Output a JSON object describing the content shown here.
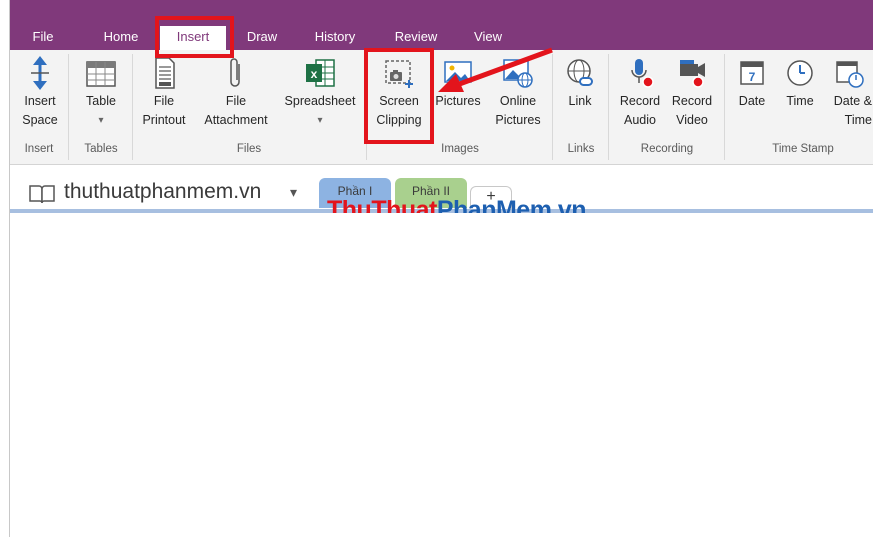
{
  "tabs": [
    "File",
    "Home",
    "Insert",
    "Draw",
    "History",
    "Review",
    "View"
  ],
  "active_tab": "Insert",
  "ribbon": {
    "insert_space": [
      "Insert",
      "Space"
    ],
    "table": [
      "Table",
      "▾"
    ],
    "file_printout": [
      "File",
      "Printout"
    ],
    "file_attachment": [
      "File",
      "Attachment"
    ],
    "spreadsheet": [
      "Spreadsheet",
      "▾"
    ],
    "screen_clipping": [
      "Screen",
      "Clipping"
    ],
    "pictures": "Pictures",
    "online_pictures": [
      "Online",
      "Pictures"
    ],
    "link": "Link",
    "record_audio": [
      "Record",
      "Audio"
    ],
    "record_video": [
      "Record",
      "Video"
    ],
    "date": "Date",
    "time": "Time",
    "date_time": [
      "Date &",
      "Time"
    ],
    "groups": [
      "Insert",
      "Tables",
      "Files",
      "Images",
      "Links",
      "Recording",
      "Time Stamp"
    ]
  },
  "notebook": {
    "name": "thuthuatphanmem.vn",
    "dropdown": "▾",
    "sections": [
      "Phần I",
      "Phần II"
    ],
    "add_section": "+"
  },
  "watermark": {
    "part1": "ThuThuat",
    "part2": "PhanMem",
    "part3": ".vn"
  },
  "colors": {
    "accent": "#80397b",
    "highlight": "#e3141c",
    "section1": "#8db3e2",
    "section2": "#a9d08e"
  }
}
